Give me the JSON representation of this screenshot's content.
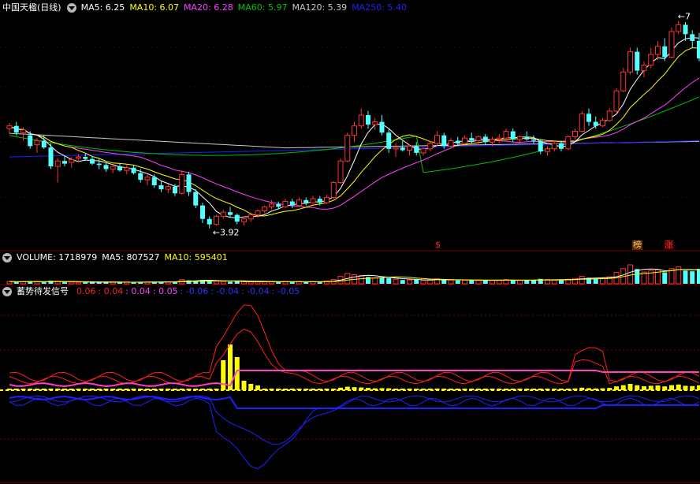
{
  "colors": {
    "bg": "#000000",
    "up": "#ff3232",
    "down": "#54ffff",
    "grid": "#7a0000",
    "ma5": "#ffffff",
    "ma10": "#ffff00",
    "ma20": "#ff40ff",
    "ma60": "#00c000",
    "ma120": "#c8c8c8",
    "ma250": "#2020ff",
    "volbar_up": "#ff3232",
    "volbar_down": "#54ffff",
    "signal_bar": "#ffff00",
    "red_line": "#ff2020",
    "magenta_line": "#ff40c0",
    "blue_line": "#2020ff"
  },
  "price_panel": {
    "title": "中国天楹(日线)",
    "indicators": [
      {
        "label": "MA5: 6.25",
        "color": "#ffffff"
      },
      {
        "label": "MA10: 6.07",
        "color": "#ffff00"
      },
      {
        "label": "MA20: 6.28",
        "color": "#ff40ff"
      },
      {
        "label": "MA60: 5.97",
        "color": "#00c000"
      },
      {
        "label": "MA120: 5.39",
        "color": "#c8c8c8"
      },
      {
        "label": "MA250: 5.40",
        "color": "#2020ff"
      }
    ],
    "low_marker": "←3.92",
    "high_marker": "←7",
    "badges": [
      {
        "text": "$",
        "color": "#ff3030"
      },
      {
        "text": "榜",
        "color": "#ffcc66"
      },
      {
        "text": "涨",
        "color": "#ff3030"
      }
    ]
  },
  "volume_panel": {
    "items": [
      {
        "label": "VOLUME: 1718979",
        "color": "#ffffff"
      },
      {
        "label": "MA5: 807527",
        "color": "#ffffff"
      },
      {
        "label": "MA10: 595401",
        "color": "#ffff00"
      }
    ]
  },
  "signal_panel": {
    "title": "蓄势待发信号",
    "items": [
      {
        "label": "0.06",
        "color": "#ff2020"
      },
      {
        "label": ": 0.04",
        "color": "#ff2020"
      },
      {
        "label": ": 0.04",
        "color": "#ff40ff"
      },
      {
        "label": ": 0.05",
        "color": "#ff40ff"
      },
      {
        "label": ": -0.06",
        "color": "#3030ff"
      },
      {
        "label": ": -0.04",
        "color": "#3030ff"
      },
      {
        "label": ": -0.04",
        "color": "#3030ff"
      },
      {
        "label": ": -0.05",
        "color": "#3030ff"
      }
    ]
  },
  "chart_data": {
    "type": "candlestick",
    "title": "中国天楹(日线)",
    "price_low": 3.92,
    "price_high": 7.0,
    "ohlc": [
      [
        5.4,
        5.48,
        5.32,
        5.44
      ],
      [
        5.44,
        5.5,
        5.3,
        5.34
      ],
      [
        5.34,
        5.42,
        5.22,
        5.38
      ],
      [
        5.3,
        5.36,
        5.1,
        5.14
      ],
      [
        5.16,
        5.26,
        5.04,
        5.22
      ],
      [
        5.22,
        5.3,
        5.1,
        5.12
      ],
      [
        5.12,
        5.18,
        4.8,
        4.84
      ],
      [
        4.84,
        4.96,
        4.6,
        4.92
      ],
      [
        4.92,
        5.0,
        4.84,
        4.88
      ],
      [
        4.9,
        4.98,
        4.82,
        4.94
      ],
      [
        4.96,
        5.02,
        4.9,
        4.98
      ],
      [
        4.98,
        5.04,
        4.92,
        4.95
      ],
      [
        4.95,
        4.99,
        4.86,
        4.88
      ],
      [
        4.88,
        4.95,
        4.8,
        4.86
      ],
      [
        4.86,
        4.9,
        4.76,
        4.8
      ],
      [
        4.8,
        4.86,
        4.74,
        4.84
      ],
      [
        4.84,
        4.88,
        4.76,
        4.78
      ],
      [
        4.78,
        4.86,
        4.72,
        4.82
      ],
      [
        4.82,
        4.86,
        4.72,
        4.74
      ],
      [
        4.74,
        4.8,
        4.6,
        4.64
      ],
      [
        4.64,
        4.72,
        4.56,
        4.68
      ],
      [
        4.68,
        4.72,
        4.52,
        4.56
      ],
      [
        4.56,
        4.62,
        4.46,
        4.5
      ],
      [
        4.5,
        4.58,
        4.44,
        4.54
      ],
      [
        4.54,
        4.58,
        4.4,
        4.44
      ],
      [
        4.44,
        4.78,
        4.42,
        4.72
      ],
      [
        4.72,
        4.76,
        4.4,
        4.46
      ],
      [
        4.46,
        4.5,
        4.22,
        4.26
      ],
      [
        4.26,
        4.3,
        4.0,
        4.06
      ],
      [
        4.06,
        4.1,
        3.92,
        3.98
      ],
      [
        3.98,
        4.12,
        3.96,
        4.1
      ],
      [
        4.1,
        4.2,
        4.06,
        4.16
      ],
      [
        4.16,
        4.24,
        4.08,
        4.12
      ],
      [
        4.12,
        4.14,
        3.98,
        4.02
      ],
      [
        4.02,
        4.1,
        3.96,
        4.06
      ],
      [
        4.06,
        4.16,
        4.02,
        4.12
      ],
      [
        4.12,
        4.2,
        4.08,
        4.18
      ],
      [
        4.18,
        4.26,
        4.14,
        4.24
      ],
      [
        4.24,
        4.34,
        4.2,
        4.28
      ],
      [
        4.28,
        4.32,
        4.2,
        4.24
      ],
      [
        4.24,
        4.36,
        4.22,
        4.32
      ],
      [
        4.32,
        4.36,
        4.22,
        4.26
      ],
      [
        4.26,
        4.38,
        4.24,
        4.34
      ],
      [
        4.34,
        4.38,
        4.26,
        4.3
      ],
      [
        4.3,
        4.4,
        4.28,
        4.36
      ],
      [
        4.36,
        4.4,
        4.26,
        4.3
      ],
      [
        4.3,
        4.42,
        4.28,
        4.38
      ],
      [
        4.38,
        4.62,
        4.36,
        4.6
      ],
      [
        4.6,
        4.96,
        4.58,
        4.92
      ],
      [
        4.92,
        5.34,
        4.9,
        5.3
      ],
      [
        5.3,
        5.5,
        5.2,
        5.44
      ],
      [
        5.44,
        5.7,
        5.4,
        5.6
      ],
      [
        5.6,
        5.66,
        5.4,
        5.46
      ],
      [
        5.46,
        5.56,
        5.38,
        5.5
      ],
      [
        5.5,
        5.6,
        5.3,
        5.34
      ],
      [
        5.34,
        5.4,
        5.04,
        5.1
      ],
      [
        5.1,
        5.18,
        4.98,
        5.12
      ],
      [
        5.12,
        5.22,
        5.06,
        5.08
      ],
      [
        5.08,
        5.16,
        5.0,
        5.14
      ],
      [
        5.14,
        5.2,
        5.0,
        5.04
      ],
      [
        5.04,
        5.12,
        5.0,
        5.1
      ],
      [
        5.1,
        5.22,
        5.06,
        5.18
      ],
      [
        5.18,
        5.36,
        5.14,
        5.3
      ],
      [
        5.3,
        5.34,
        5.1,
        5.14
      ],
      [
        5.14,
        5.26,
        5.1,
        5.22
      ],
      [
        5.22,
        5.28,
        5.14,
        5.18
      ],
      [
        5.18,
        5.3,
        5.16,
        5.26
      ],
      [
        5.26,
        5.34,
        5.18,
        5.22
      ],
      [
        5.22,
        5.3,
        5.16,
        5.28
      ],
      [
        5.28,
        5.32,
        5.16,
        5.2
      ],
      [
        5.2,
        5.28,
        5.14,
        5.24
      ],
      [
        5.24,
        5.32,
        5.18,
        5.26
      ],
      [
        5.26,
        5.4,
        5.22,
        5.36
      ],
      [
        5.36,
        5.4,
        5.2,
        5.24
      ],
      [
        5.24,
        5.3,
        5.18,
        5.28
      ],
      [
        5.28,
        5.36,
        5.22,
        5.24
      ],
      [
        5.24,
        5.3,
        5.18,
        5.22
      ],
      [
        5.22,
        5.24,
        5.02,
        5.06
      ],
      [
        5.06,
        5.14,
        5.0,
        5.1
      ],
      [
        5.1,
        5.22,
        5.06,
        5.18
      ],
      [
        5.18,
        5.22,
        5.06,
        5.1
      ],
      [
        5.1,
        5.3,
        5.08,
        5.28
      ],
      [
        5.28,
        5.4,
        5.24,
        5.36
      ],
      [
        5.36,
        5.66,
        5.34,
        5.62
      ],
      [
        5.62,
        5.7,
        5.44,
        5.5
      ],
      [
        5.5,
        5.58,
        5.4,
        5.44
      ],
      [
        5.44,
        5.56,
        5.42,
        5.52
      ],
      [
        5.52,
        5.7,
        5.5,
        5.66
      ],
      [
        5.66,
        6.0,
        5.64,
        5.96
      ],
      [
        5.96,
        6.3,
        5.94,
        6.24
      ],
      [
        6.24,
        6.6,
        6.2,
        6.54
      ],
      [
        6.54,
        6.6,
        6.2,
        6.26
      ],
      [
        6.26,
        6.4,
        6.16,
        6.34
      ],
      [
        6.34,
        6.6,
        6.3,
        6.5
      ],
      [
        6.5,
        6.7,
        6.42,
        6.62
      ],
      [
        6.62,
        6.74,
        6.4,
        6.46
      ],
      [
        6.46,
        6.9,
        6.44,
        6.84
      ],
      [
        6.84,
        7.0,
        6.8,
        6.94
      ],
      [
        6.94,
        6.98,
        6.7,
        6.8
      ],
      [
        6.8,
        6.86,
        6.6,
        6.7
      ],
      [
        6.7,
        6.82,
        6.4,
        6.44
      ]
    ],
    "volume": [
      0.12,
      0.1,
      0.11,
      0.14,
      0.1,
      0.09,
      0.16,
      0.13,
      0.1,
      0.09,
      0.08,
      0.08,
      0.09,
      0.08,
      0.08,
      0.09,
      0.08,
      0.09,
      0.08,
      0.1,
      0.09,
      0.1,
      0.11,
      0.1,
      0.12,
      0.22,
      0.18,
      0.16,
      0.2,
      0.17,
      0.14,
      0.12,
      0.11,
      0.13,
      0.11,
      0.1,
      0.1,
      0.11,
      0.12,
      0.1,
      0.11,
      0.1,
      0.12,
      0.1,
      0.11,
      0.1,
      0.14,
      0.22,
      0.4,
      0.55,
      0.48,
      0.44,
      0.36,
      0.3,
      0.32,
      0.3,
      0.24,
      0.2,
      0.2,
      0.22,
      0.18,
      0.2,
      0.26,
      0.22,
      0.2,
      0.18,
      0.19,
      0.2,
      0.18,
      0.19,
      0.18,
      0.18,
      0.22,
      0.2,
      0.18,
      0.18,
      0.2,
      0.26,
      0.22,
      0.2,
      0.2,
      0.24,
      0.28,
      0.4,
      0.32,
      0.28,
      0.3,
      0.36,
      0.6,
      0.8,
      1.0,
      0.78,
      0.62,
      0.7,
      0.74,
      0.6,
      0.8,
      0.9,
      0.7,
      0.66,
      0.78
    ],
    "volume_ma5": 807527,
    "volume_ma10": 595401,
    "ma": {
      "MA5": 6.25,
      "MA10": 6.07,
      "MA20": 6.28,
      "MA60": 5.97,
      "MA120": 5.39,
      "MA250": 5.4
    },
    "signal_values": [
      0.06,
      0.04,
      0.04,
      0.05,
      -0.06,
      -0.04,
      -0.04,
      -0.05
    ]
  }
}
